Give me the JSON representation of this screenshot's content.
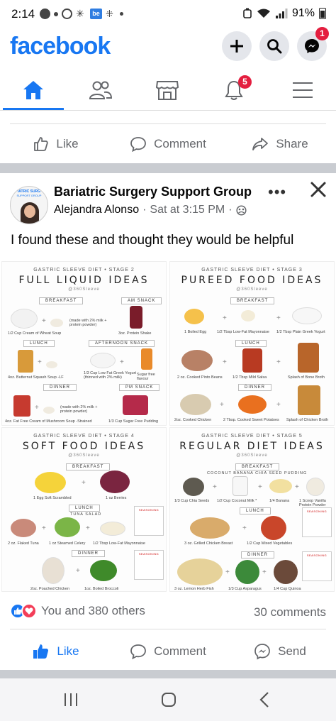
{
  "status_bar": {
    "time": "2:14",
    "battery": "91%",
    "notification_box_label": "be"
  },
  "header": {
    "logo": "facebook",
    "notifications_badge": "1"
  },
  "nav": {
    "tabs": [
      "home-icon",
      "friends-icon",
      "marketplace-icon",
      "notifications-icon",
      "menu-icon"
    ],
    "notifications_badge": "5",
    "active_tab": "home"
  },
  "prev_post_actions": {
    "like": "Like",
    "comment": "Comment",
    "share": "Share"
  },
  "post": {
    "group_name": "Bariatric Surgery Support Group",
    "author": "Alejandra Alonso",
    "time": "Sat at 3:15 PM",
    "separator": "·",
    "text": "I found these and thought they would be helpful",
    "avatar_label_top": "IATRIC SURG",
    "avatar_label_bottom": "SUPPORT GROUP",
    "infographic": {
      "panels": [
        {
          "stage": "GASTRIC SLEEVE DIET • STAGE 2",
          "title": "FULL LIQUID IDEAS",
          "handle": "@360Sleeve",
          "meals": [
            "BREAKFAST",
            "AM SNACK",
            "LUNCH",
            "AFTERNOON SNACK",
            "DINNER",
            "PM SNACK"
          ],
          "labels": [
            "(made with 2% milk + protein powder)",
            "1/2 Cup Cream of Wheat Soup",
            "3oz. Protein Shake",
            "4oz. Butternut Squash Soup -LF",
            "1/3 Cup Low Fat Greek Yogurt (thinned with 2% milk)",
            "Sugar free flavour",
            "(made with 2% milk + protein powder)",
            "4oz. Fat Free Cream of Mushroom Soup -Strained",
            "1/3 Cup Sugar Free Pudding"
          ]
        },
        {
          "stage": "GASTRIC SLEEVE DIET • STAGE 3",
          "title": "PUREED FOOD IDEAS",
          "handle": "@360Sleeve",
          "meals": [
            "BREAKFAST",
            "LUNCH",
            "DINNER"
          ],
          "labels": [
            "1 Boiled Egg",
            "1/2 Tbsp Low-Fat Mayonnaise",
            "1/2 Tbsp Plain Greek Yogurt",
            "2 oz. Cooked Pinto Beans",
            "1/2 Tbsp Mild Salsa",
            "Splash of Bone Broth",
            "2oz. Cooked Chicken",
            "2 Tbsp. Cooked Sweet Potatoes",
            "Splash of Chicken Broth"
          ]
        },
        {
          "stage": "GASTRIC SLEEVE DIET • STAGE 4",
          "title": "SOFT FOOD IDEAS",
          "handle": "@360Sleeve",
          "meals": [
            "BREAKFAST",
            "LUNCH",
            "DINNER"
          ],
          "sub": "TUNA SALAD",
          "seasoning": "SEASONING",
          "labels": [
            "1 Egg Soft Scrambled",
            "1 oz Berries",
            "2 oz. Flaked Tuna",
            "1 oz Steamed Celery",
            "1/2 Tbsp Low-Fat Mayonnaise",
            "2oz. Poached Chicken",
            "1oz. Boiled Broccoli"
          ]
        },
        {
          "stage": "GASTRIC SLEEVE DIET • STAGE 5",
          "title": "REGULAR DIET IDEAS",
          "handle": "@360Sleeve",
          "meals": [
            "BREAKFAST",
            "LUNCH",
            "DINNER"
          ],
          "sub": "COCONUT BANANA CHIA SEED PUDDING",
          "seasoning": "SEASONING",
          "labels": [
            "1/3 Cup Chia Seeds",
            "1/2 Cup Coconut Milk *",
            "1/4 Banana",
            "1 Scoop Vanilla Protein Powder",
            "3 oz. Grilled Chicken Breast",
            "1/2 Cup Mixed Vegetables",
            "3 oz. Lemon Herb Fish",
            "1/3 Cup Asparagus",
            "1/4 Cup Quinoa"
          ]
        }
      ]
    }
  },
  "reactions": {
    "summary": "You and 380 others",
    "comments": "30 comments",
    "like_color": "#1877f2",
    "love_color": "#f33e58"
  },
  "post_actions": {
    "like": "Like",
    "comment": "Comment",
    "send": "Send"
  },
  "colors": {
    "brand": "#1877f2",
    "badge": "#e41e3f",
    "divider": "#c9ccd1"
  }
}
